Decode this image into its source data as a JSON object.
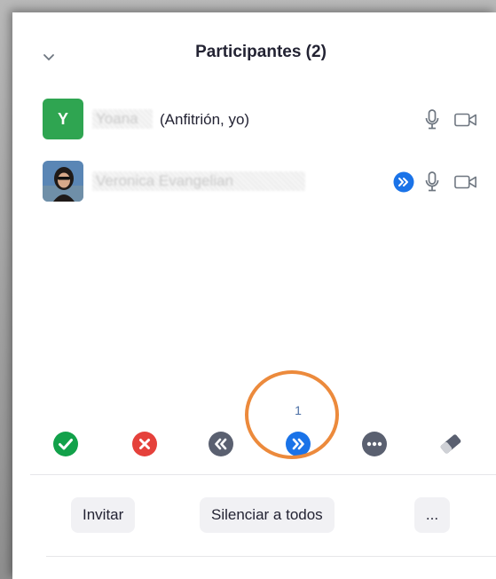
{
  "panel": {
    "title": "Participantes (2)"
  },
  "participants": [
    {
      "avatar_letter": "Y",
      "name": "Yoana",
      "role": "(Anfitrión, yo)"
    },
    {
      "name": "Veronica Evangelian"
    }
  ],
  "breakout": {
    "count": "1"
  },
  "footer": {
    "invite_label": "Invitar",
    "mute_all_label": "Silenciar a todos",
    "more_label": "..."
  },
  "colors": {
    "accent_blue": "#1a73e8",
    "yes_green": "#12a14a",
    "no_red": "#e5413b",
    "neutral_gray": "#5a6070",
    "highlight_orange": "#ec8a3c"
  }
}
